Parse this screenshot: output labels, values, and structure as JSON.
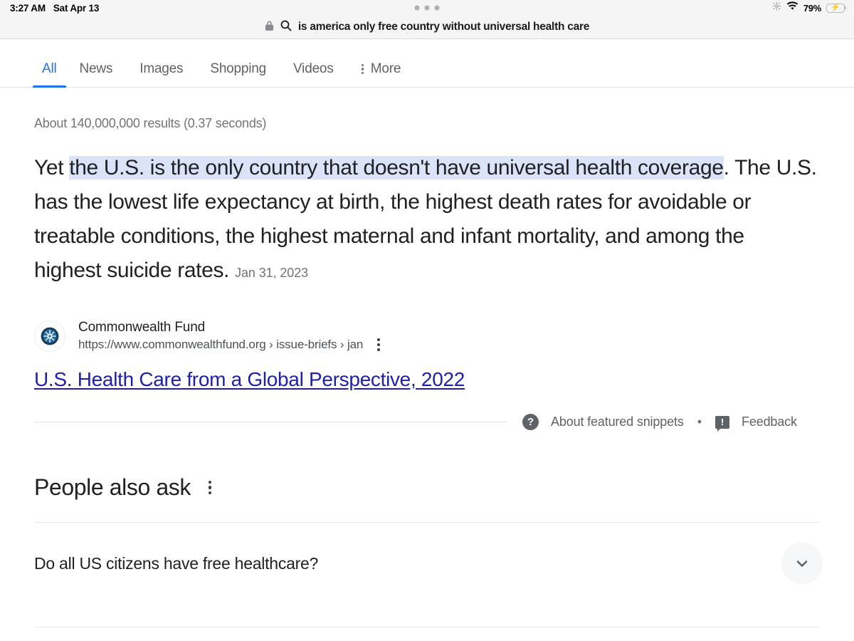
{
  "statusbar": {
    "time": "3:27 AM",
    "date": "Sat Apr 13",
    "battery_percent": "79%",
    "wifi_icon": "wifi-icon",
    "brightness_icon": "brightness-icon",
    "battery_icon": "battery-charging-icon",
    "multitask_icon": "multitask-dots-icon"
  },
  "addressbar": {
    "lock_icon": "lock-icon",
    "search_icon": "search-icon",
    "query": "is america only free country without universal health care"
  },
  "tabs": {
    "items": [
      {
        "label": "All",
        "active": true
      },
      {
        "label": "News",
        "active": false
      },
      {
        "label": "Images",
        "active": false
      },
      {
        "label": "Shopping",
        "active": false
      },
      {
        "label": "Videos",
        "active": false
      }
    ],
    "more_label": "More",
    "more_icon": "kebab-menu-icon"
  },
  "results": {
    "stats": "About 140,000,000 results (0.37 seconds)"
  },
  "snippet": {
    "lead_text": "Yet ",
    "highlight_text": "the U.S. is the only country that doesn't have universal health coverage",
    "rest_text": ". The U.S. has the lowest life expectancy at birth, the highest death rates for avoidable or treatable conditions, the highest maternal and infant mortality, and among the highest suicide rates.",
    "date": "Jan 31, 2023",
    "highlight_color": "#dae3f7"
  },
  "source": {
    "favicon_icon": "commonwealth-fund-favicon",
    "site_name": "Commonwealth Fund",
    "url": "https://www.commonwealthfund.org › issue-briefs › jan",
    "menu_icon": "kebab-menu-icon",
    "title": "U.S. Health Care from a Global Perspective, 2022",
    "link_color": "#1f1fa8"
  },
  "snippet_footer": {
    "help_icon": "question-mark-icon",
    "about_label": "About featured snippets",
    "separator": "•",
    "feedback_icon": "feedback-flag-icon",
    "feedback_label": "Feedback"
  },
  "people_also_ask": {
    "title": "People also ask",
    "menu_icon": "kebab-menu-icon",
    "questions": [
      {
        "text": "Do all US citizens have free healthcare?",
        "expand_icon": "chevron-down-icon"
      }
    ]
  }
}
